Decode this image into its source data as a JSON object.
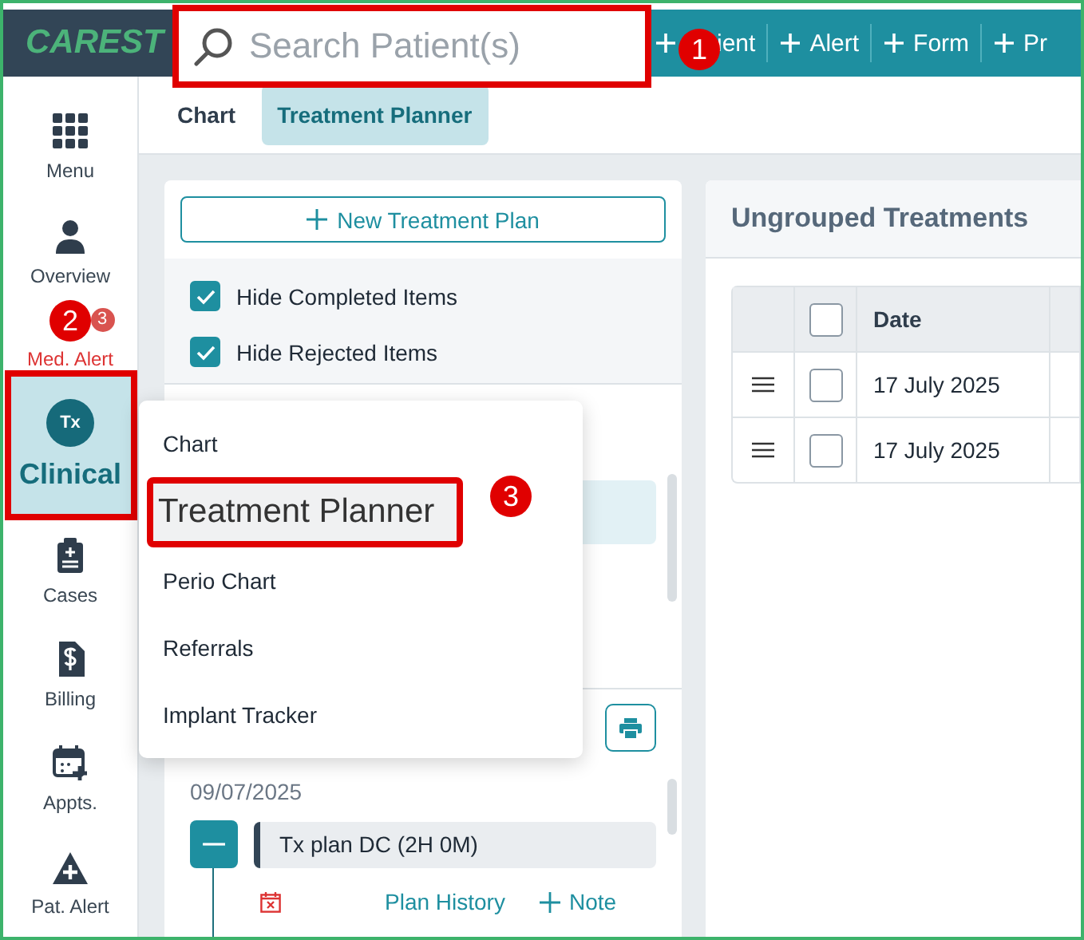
{
  "top_bar": {
    "logo": "CAREST",
    "search": {
      "placeholder": "Search Patient(s)"
    },
    "actions": [
      "ient",
      "Alert",
      "Form",
      "Pr"
    ]
  },
  "sidebar": {
    "items": [
      {
        "label": "Menu",
        "kind": "nav",
        "selected": false
      },
      {
        "label": "Overview",
        "kind": "nav",
        "selected": false
      },
      {
        "label": "Med. Alert",
        "kind": "alert",
        "badge": "3",
        "selected": false
      },
      {
        "label": "Clinical",
        "kind": "nav",
        "icon_text": "Tx",
        "selected": true
      },
      {
        "label": "Cases",
        "kind": "nav",
        "selected": false
      },
      {
        "label": "Billing",
        "kind": "nav",
        "selected": false
      },
      {
        "label": "Appts.",
        "kind": "nav",
        "selected": false
      },
      {
        "label": "Pat. Alert",
        "kind": "nav",
        "selected": false
      }
    ]
  },
  "tabs": [
    {
      "label": "Chart",
      "selected": false
    },
    {
      "label": "Treatment Planner",
      "selected": true
    }
  ],
  "plans_panel": {
    "new_button": "New Treatment Plan",
    "filters": [
      {
        "label": "Hide Completed Items",
        "checked": true
      },
      {
        "label": "Hide Rejected Items",
        "checked": true
      }
    ],
    "date": "09/07/2025",
    "plan": {
      "title": "Tx plan DC (2H 0M)",
      "expanded": true
    },
    "links": [
      "Plan History",
      "Note"
    ]
  },
  "context_menu": {
    "items": [
      {
        "label": "Chart",
        "selected": false
      },
      {
        "label": "Treatment Planner",
        "selected": true
      },
      {
        "label": "Perio Chart",
        "selected": false
      },
      {
        "label": "Referrals",
        "selected": false
      },
      {
        "label": "Implant Tracker",
        "selected": false
      }
    ]
  },
  "ungrouped": {
    "title": "Ungrouped Treatments",
    "all_checked": false,
    "columns": [
      "Date"
    ],
    "rows": [
      {
        "date": "17 July 2025",
        "checked": false
      },
      {
        "date": "17 July 2025",
        "checked": false
      }
    ]
  },
  "callouts": [
    "1",
    "2",
    "3"
  ]
}
